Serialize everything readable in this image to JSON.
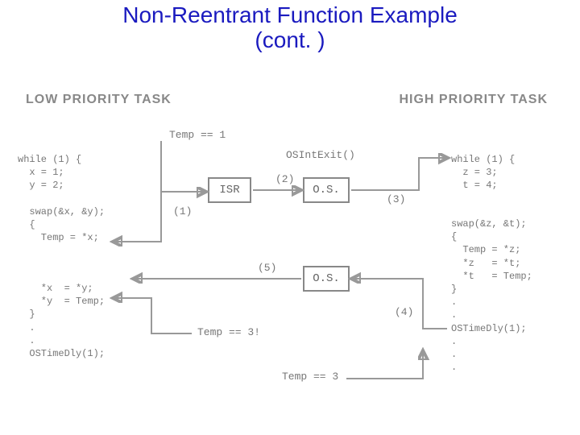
{
  "title_line1": "Non-Reentrant Function Example",
  "title_line2": "(cont. )",
  "sections": {
    "low": "LOW PRIORITY TASK",
    "high": "HIGH PRIORITY TASK"
  },
  "boxes": {
    "isr": "ISR",
    "os1": "O.S.",
    "os2": "O.S."
  },
  "labels": {
    "temp1": "Temp == 1",
    "osintexit": "OSIntExit()",
    "temp3ex": "Temp == 3!",
    "temp3": "Temp == 3"
  },
  "steps": {
    "s1": "(1)",
    "s2": "(2)",
    "s3": "(3)",
    "s4": "(4)",
    "s5": "(5)"
  },
  "code_left_top": "while (1) {\n  x = 1;\n  y = 2;\n\n  swap(&x, &y);\n  {\n    Temp = *x;",
  "code_left_bottom": "    *x  = *y;\n    *y  = Temp;\n  }\n  .\n  .\n  OSTimeDly(1);",
  "code_right_top": "while (1) {\n  z = 3;\n  t = 4;",
  "code_right_swap": "swap(&z, &t);\n{\n  Temp = *z;\n  *z   = *t;\n  *t   = Temp;\n}\n.\n.\nOSTimeDly(1);\n.\n.\n."
}
